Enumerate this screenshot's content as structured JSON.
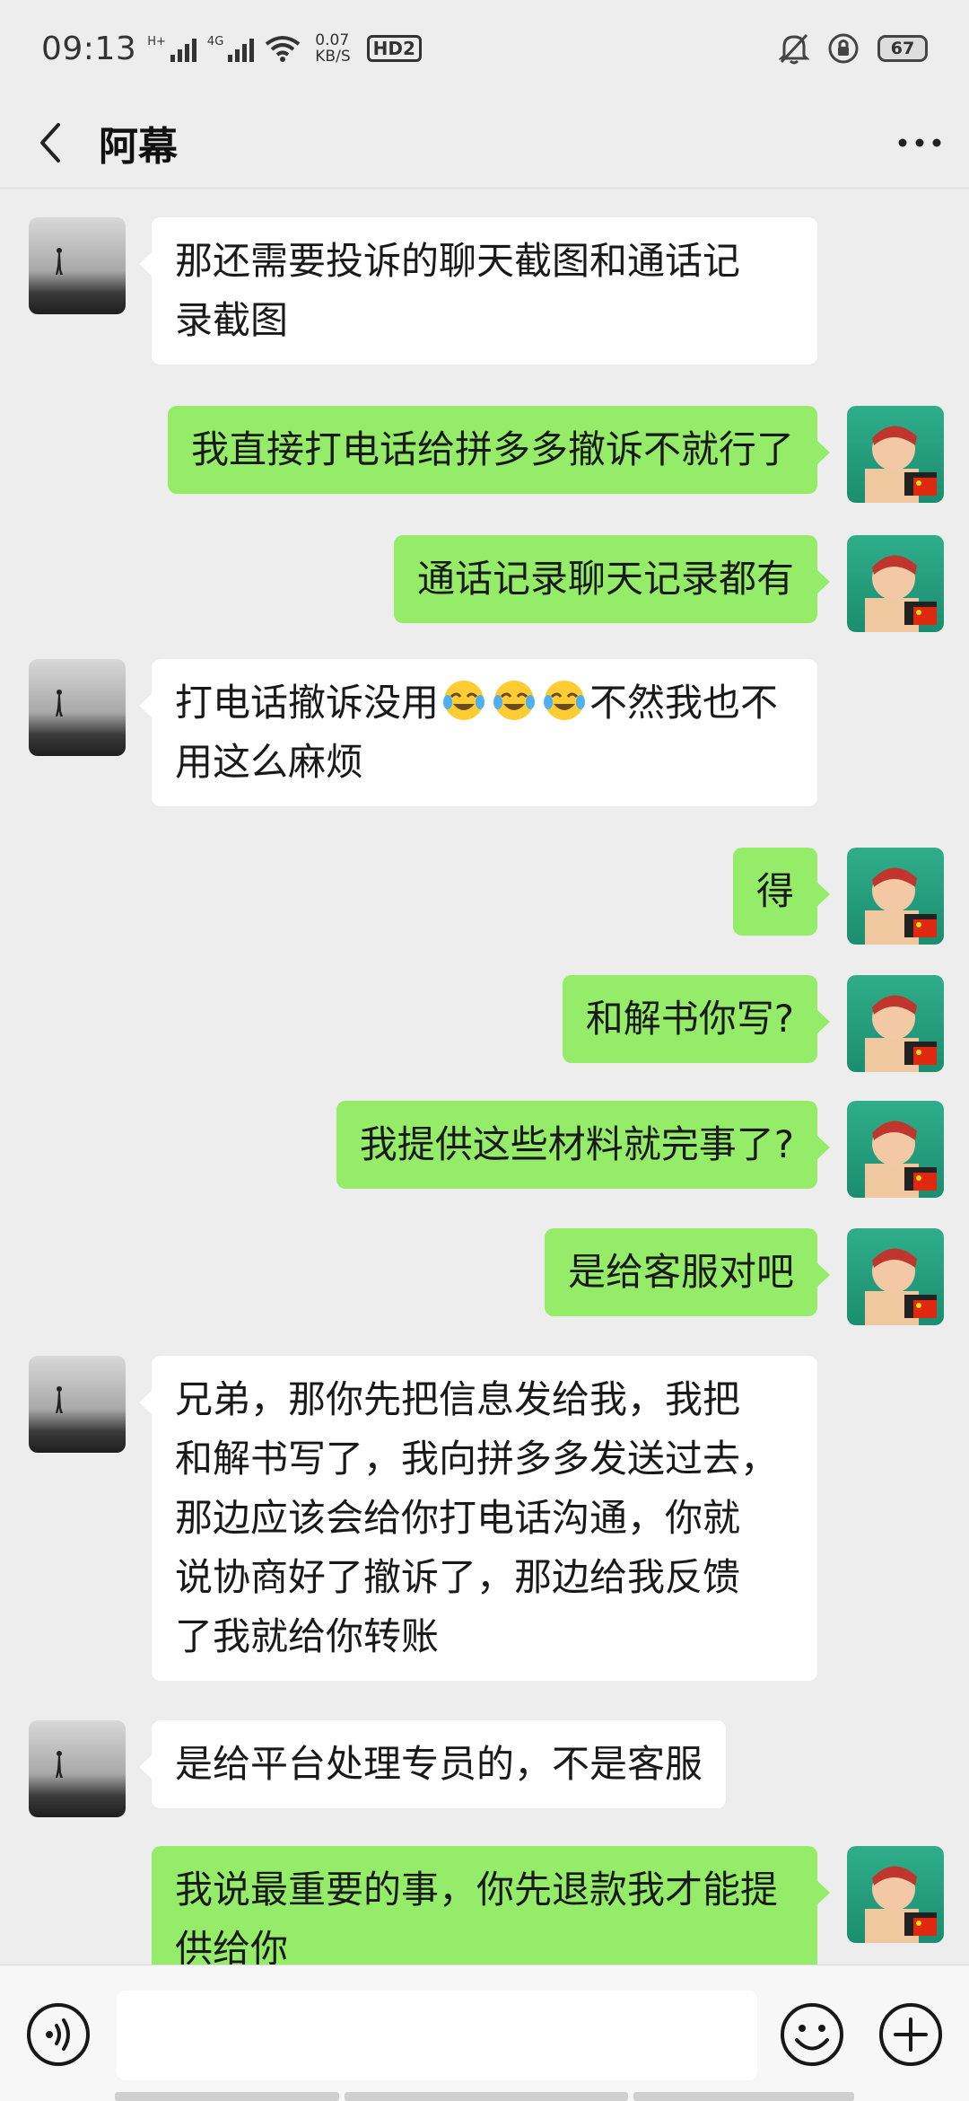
{
  "status_bar": {
    "time": "09:13",
    "signal1_label": "H+",
    "signal2_label": "4G",
    "net_speed": "0.07",
    "net_unit": "KB/S",
    "hd_badge": "HD2",
    "battery": "67"
  },
  "header": {
    "title": "阿幕"
  },
  "messages": [
    {
      "side": "left",
      "text": "那还需要投诉的聊天截图和通话记\n录截图"
    },
    {
      "side": "right",
      "text": "我直接打电话给拼多多撤诉不就行了"
    },
    {
      "side": "right",
      "text": "通话记录聊天记录都有"
    },
    {
      "side": "left",
      "text_before": "打电话撤诉没用",
      "emoji_name": "face-with-tears-of-joy-emoji",
      "text_after": "不然我也不\n用这么麻烦"
    },
    {
      "side": "right",
      "text": "得"
    },
    {
      "side": "right",
      "text": "和解书你写?"
    },
    {
      "side": "right",
      "text": "我提供这些材料就完事了?"
    },
    {
      "side": "right",
      "text": "是给客服对吧"
    },
    {
      "side": "left",
      "text": "兄弟，那你先把信息发给我，我把\n和解书写了，我向拼多多发送过去，\n那边应该会给你打电话沟通，你就\n说协商好了撤诉了，那边给我反馈\n了我就给你转账"
    },
    {
      "side": "left",
      "text": "是给平台处理专员的，不是客服"
    },
    {
      "side": "right",
      "text": "我说最重要的事，你先退款我才能提\n供给你"
    }
  ],
  "input_bar": {
    "voice_icon": "voice-icon",
    "emoji_icon": "emoji-icon",
    "plus_icon": "plus-icon"
  },
  "colors": {
    "background": "#ededed",
    "my_bubble": "#95ec69",
    "their_bubble": "#ffffff"
  }
}
